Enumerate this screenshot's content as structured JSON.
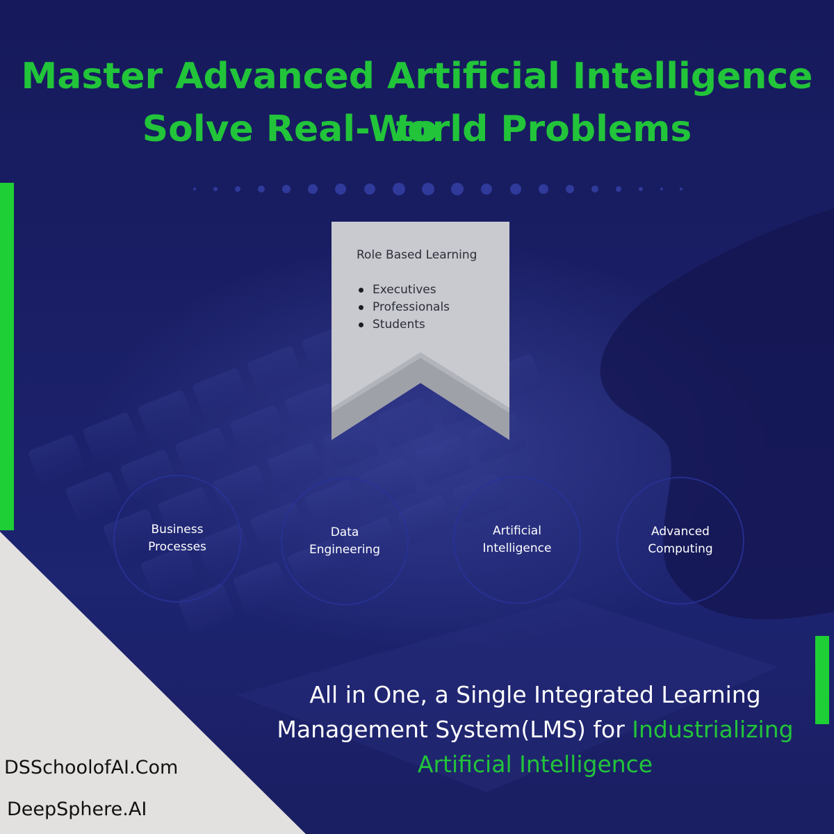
{
  "headline": {
    "line1": "Master Advanced Artificial Intelligence to",
    "line2": "Solve Real-World Problems"
  },
  "ribbon": {
    "title": "Role Based Learning",
    "items": [
      "Executives",
      "Professionals",
      "Students"
    ]
  },
  "circles": [
    {
      "line1": "Business",
      "line2": "Processes"
    },
    {
      "line1": "Data",
      "line2": "Engineering"
    },
    {
      "line1": "Artificial",
      "line2": "Intelligence"
    },
    {
      "line1": "Advanced",
      "line2": "Computing"
    }
  ],
  "tagline": {
    "line1": "All in One, a Single Integrated Learning",
    "line2_plain": "Management System(LMS) for ",
    "line2_highlight": "Industrializing",
    "line3_highlight": "Artificial Intelligence"
  },
  "footer": {
    "site1": "DSSchoolofAI.Com",
    "site2": "DeepSphere.AI"
  },
  "colors": {
    "background": "#16195a",
    "accent_green": "#22c43a",
    "ribbon_gray": "#c4c6cc",
    "corner_gray": "#e3e1df",
    "text_white": "#ffffff"
  }
}
